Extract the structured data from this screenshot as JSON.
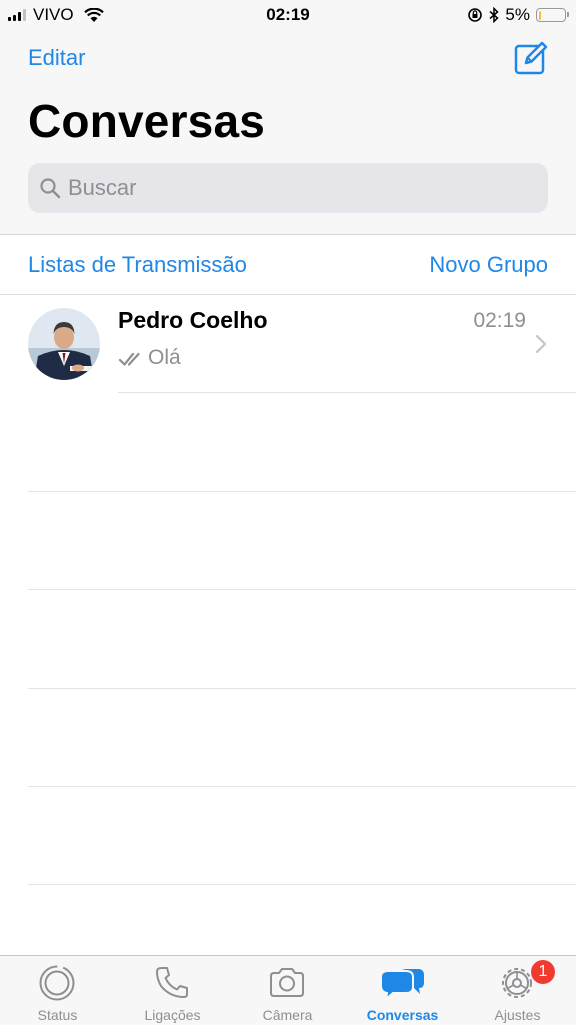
{
  "status_bar": {
    "carrier": "VIVO",
    "time": "02:19",
    "battery": "5%",
    "battery_level": 0.05
  },
  "header": {
    "edit_label": "Editar",
    "title": "Conversas"
  },
  "search": {
    "placeholder": "Buscar"
  },
  "actions": {
    "broadcast_label": "Listas de Transmissão",
    "new_group_label": "Novo Grupo"
  },
  "chats": [
    {
      "name": "Pedro Coelho",
      "time": "02:19",
      "preview": "Olá",
      "status_icon": "double-check-icon"
    }
  ],
  "tabs": [
    {
      "label": "Status",
      "icon": "status-icon",
      "active": false
    },
    {
      "label": "Ligações",
      "icon": "phone-icon",
      "active": false
    },
    {
      "label": "Câmera",
      "icon": "camera-icon",
      "active": false
    },
    {
      "label": "Conversas",
      "icon": "chats-icon",
      "active": true
    },
    {
      "label": "Ajustes",
      "icon": "settings-gear-icon",
      "active": false,
      "badge": "1"
    }
  ],
  "colors": {
    "accent": "#1f87e6",
    "badge": "#f23b30",
    "secondary_text": "#8e8e93",
    "battery": "#f4c230"
  }
}
